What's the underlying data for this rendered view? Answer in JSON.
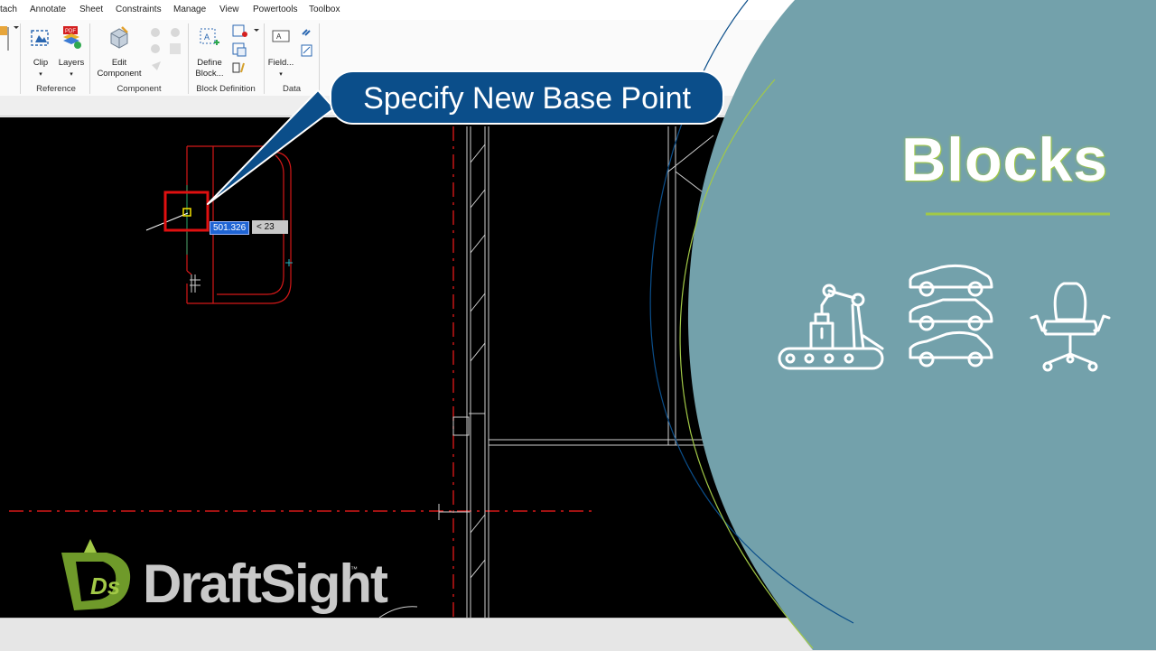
{
  "menu": {
    "items": [
      "tach",
      "Annotate",
      "Sheet",
      "Constraints",
      "Manage",
      "View",
      "Powertools",
      "Toolbox"
    ]
  },
  "ribbon": {
    "buttons": {
      "clip": "Clip",
      "layers": "Layers",
      "edit_component": "Edit\nComponent",
      "define_block": "Define\nBlock...",
      "field": "Field..."
    },
    "groups": {
      "reference": "Reference",
      "component": "Component",
      "block_definition": "Block Definition",
      "data": "Data"
    },
    "pdf_badge": "PDF"
  },
  "tooltip": {
    "text": "Specify New Base Point"
  },
  "dynamic_input": {
    "distance": "501.326",
    "angle": "< 23",
    "degree_symbol": "°"
  },
  "panel": {
    "title": "Blocks",
    "icons": [
      "robot-conveyor-icon",
      "cars-stack-icon",
      "office-chair-icon"
    ]
  },
  "logo": {
    "mark": "Ds",
    "name": "DraftSight",
    "tm": "™"
  },
  "colors": {
    "panel_bg": "#73a1ab",
    "accent_green": "#a2c947",
    "tooltip_blue": "#0b4e8a",
    "selection_red": "#e01010"
  }
}
